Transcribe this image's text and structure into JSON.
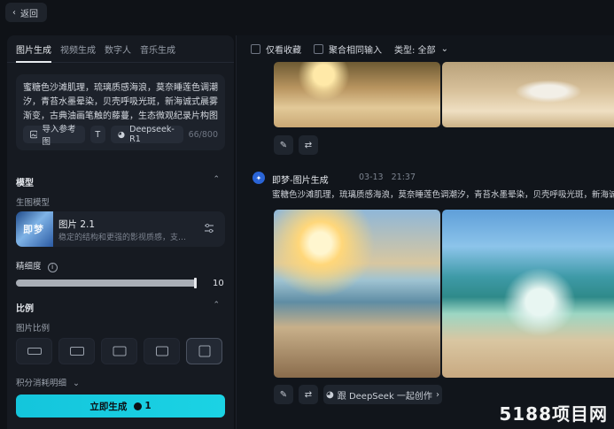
{
  "topbar": {
    "back_label": "返回"
  },
  "tabs": [
    {
      "label": "图片生成",
      "active": true
    },
    {
      "label": "视频生成",
      "active": false
    },
    {
      "label": "数字人",
      "active": false
    },
    {
      "label": "音乐生成",
      "active": false
    }
  ],
  "prompt": {
    "text": "蜜糖色沙滩肌理，琉璃质感海浪，莫奈睡莲色调潮汐，青苔水墨晕染，贝壳呼吸光斑，新海诚式晨雾渐变，古典油画笔触的藤蔓，生态微观纪录片构图",
    "ref_button": "导入参考图",
    "model_chip": "Deepseek-R1",
    "counter": "66/800"
  },
  "model_section": {
    "title": "模型",
    "sub": "生图模型",
    "name": "图片 2.1",
    "desc": "稳定的结构和更强的影视质感，支持..."
  },
  "detail": {
    "label": "精细度",
    "value": "10",
    "level_fraction": 1.0
  },
  "ratio_section": {
    "title": "比例",
    "sub": "图片比例"
  },
  "points_label": "积分消耗明细",
  "generate": {
    "label": "立即生成",
    "cost": "1"
  },
  "filters": {
    "favorites": "仅看收藏",
    "merge": "聚合相同输入",
    "type": "类型: 全部"
  },
  "entry": {
    "title": "即梦-图片生成",
    "date": "03-13",
    "time": "21:37",
    "prompt": "蜜糖色沙滩肌理，琉璃质感海浪，莫奈睡莲色调潮汐，青苔水墨晕染，贝壳呼吸光斑，新海诚式晨雾"
  },
  "cocreate": "跟 DeepSeek 一起创作",
  "watermark": "5188项目网"
}
